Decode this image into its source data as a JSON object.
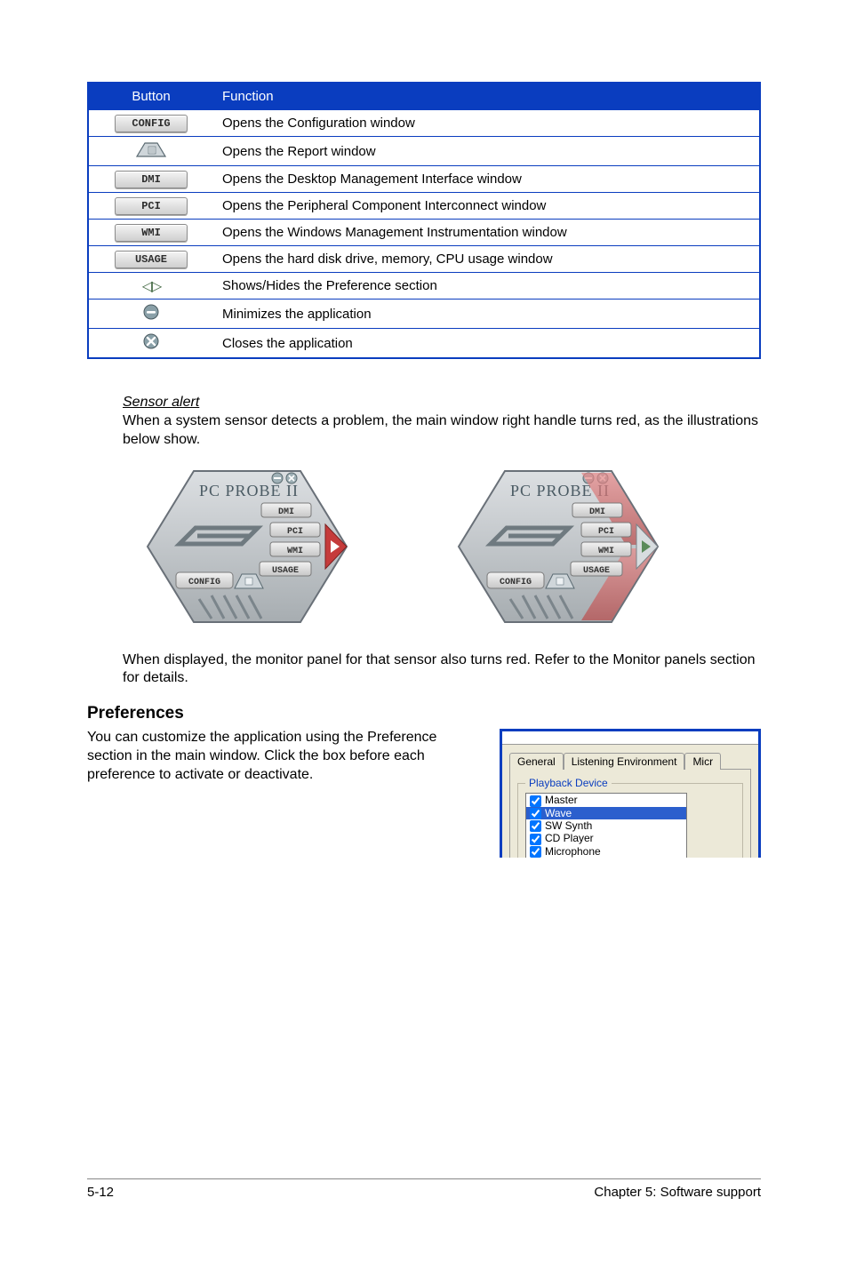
{
  "table": {
    "header": {
      "button": "Button",
      "function": "Function"
    },
    "rows": [
      {
        "btn_label": "CONFIG",
        "text": "Opens the Configuration window"
      },
      {
        "btn_label": null,
        "icon": "report-tab",
        "text": "Opens the Report window"
      },
      {
        "btn_label": "DMI",
        "text": "Opens the Desktop Management Interface window"
      },
      {
        "btn_label": "PCI",
        "text": "Opens the Peripheral Component Interconnect window"
      },
      {
        "btn_label": "WMI",
        "text": "Opens the Windows Management Instrumentation window"
      },
      {
        "btn_label": "USAGE",
        "text": "Opens the hard disk drive, memory, CPU usage window"
      },
      {
        "btn_label": null,
        "icon": "arrows",
        "text": "Shows/Hides the Preference section"
      },
      {
        "btn_label": null,
        "icon": "minimize",
        "text": "Minimizes the application"
      },
      {
        "btn_label": null,
        "icon": "close",
        "text": "Closes the application"
      }
    ]
  },
  "sensor": {
    "title": "Sensor alert",
    "p1": "When a system sensor detects a problem, the main window right handle turns red, as the illustrations below show.",
    "p2": "When displayed, the monitor panel for that sensor also turns red. Refer to the Monitor panels section for details."
  },
  "hex": {
    "title": "PC PROBE II",
    "labels": {
      "dmi": "DMI",
      "pci": "PCI",
      "wmi": "WMI",
      "usage": "USAGE",
      "config": "CONFIG"
    }
  },
  "preferences": {
    "heading": "Preferences",
    "text": "You can customize the application using the Preference section in the main window. Click the box before each preference to activate or deactivate.",
    "tabs": {
      "general": "General",
      "listening": "Listening Environment",
      "micr": "Micr"
    },
    "group": "Playback Device",
    "items": [
      {
        "label": "Master",
        "checked": true,
        "selected": false
      },
      {
        "label": "Wave",
        "checked": true,
        "selected": true
      },
      {
        "label": "SW Synth",
        "checked": true,
        "selected": false
      },
      {
        "label": "CD Player",
        "checked": true,
        "selected": false
      },
      {
        "label": "Microphone",
        "checked": true,
        "selected": false
      }
    ]
  },
  "footer": {
    "left": "5-12",
    "right": "Chapter 5: Software support"
  }
}
